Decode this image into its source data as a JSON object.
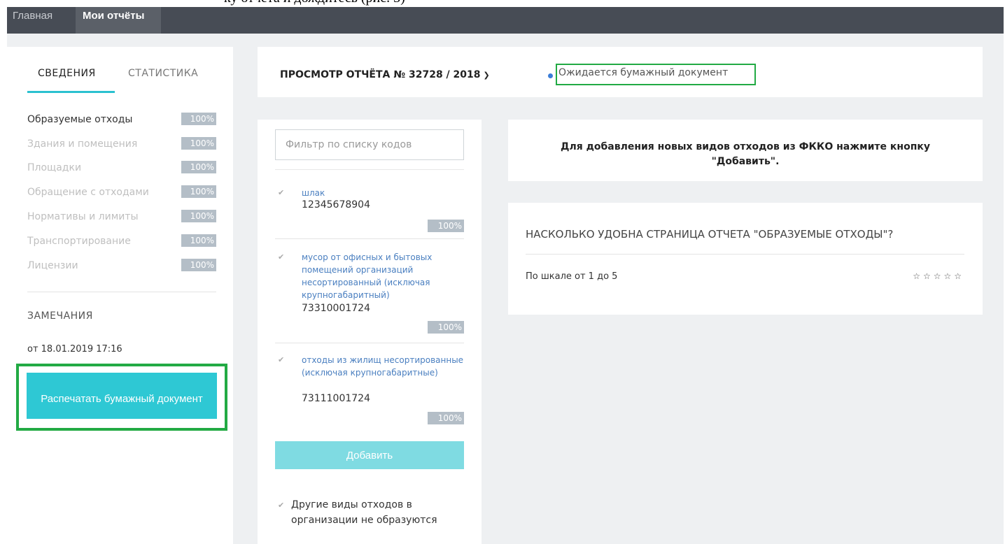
{
  "doc_fragment": "ку отчёта и дождитесь (рис. 3)",
  "topnav": {
    "home": "Главная",
    "reports": "Мои отчёты"
  },
  "sidebar": {
    "tabs": [
      "СВЕДЕНИЯ",
      "СТАТИСТИКА"
    ],
    "sections": [
      {
        "label": "Образуемые отходы",
        "pct": "100%",
        "active": true
      },
      {
        "label": "Здания и помещения",
        "pct": "100%",
        "active": false
      },
      {
        "label": "Площадки",
        "pct": "100%",
        "active": false
      },
      {
        "label": "Обращение с отходами",
        "pct": "100%",
        "active": false
      },
      {
        "label": "Нормативы и лимиты",
        "pct": "100%",
        "active": false
      },
      {
        "label": "Транспортирование",
        "pct": "100%",
        "active": false
      },
      {
        "label": "Лицензии",
        "pct": "100%",
        "active": false
      }
    ],
    "remarks_title": "ЗАМЕЧАНИЯ",
    "remarks_date": "от 18.01.2019 17:16",
    "print_button": "Распечатать бумажный документ"
  },
  "header": {
    "report_title": "ПРОСМОТР ОТЧЁТА № 32728 / 2018",
    "status": "Ожидается бумажный документ"
  },
  "codes": {
    "filter_placeholder": "Фильтр по списку кодов",
    "items": [
      {
        "name": "шлак",
        "code": "12345678904",
        "pct": "100%"
      },
      {
        "name": "мусор от офисных и бытовых помещений организаций несортированный (исключая крупногабаритный)",
        "code": "73310001724",
        "pct": "100%"
      },
      {
        "name": "отходы из жилищ несортированные (исключая крупногабаритные)",
        "code": "73111001724",
        "pct": "100%"
      }
    ],
    "add_button": "Добавить",
    "other_checkbox": "Другие виды отходов в организации не образуются"
  },
  "info": {
    "text": "Для добавления новых видов отходов из ФККО нажмите кнопку \"Добавить\"."
  },
  "survey": {
    "title": "НАСКОЛЬКО УДОБНА СТРАНИЦА ОТЧЕТА \"ОБРАЗУЕМЫЕ ОТХОДЫ\"?",
    "scale_label": "По шкале от 1 до 5",
    "stars": "☆☆☆☆☆"
  },
  "colors": {
    "accent": "#2ec8d4",
    "highlight": "#22aa44",
    "topbar": "#474c55",
    "badge": "#b4bec7"
  }
}
